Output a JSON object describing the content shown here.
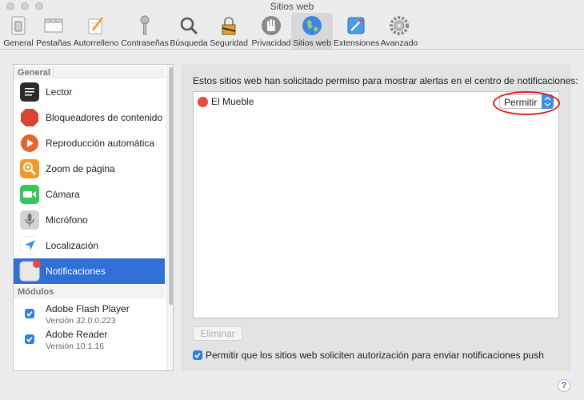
{
  "window": {
    "title": "Sitios web"
  },
  "toolbar": {
    "items": [
      {
        "label": "General",
        "icon": "switch-icon"
      },
      {
        "label": "Pestañas",
        "icon": "tabs-icon"
      },
      {
        "label": "Autorrelleno",
        "icon": "pencil-icon"
      },
      {
        "label": "Contraseñas",
        "icon": "key-icon"
      },
      {
        "label": "Búsqueda",
        "icon": "magnifier-icon"
      },
      {
        "label": "Seguridad",
        "icon": "lock-icon"
      },
      {
        "label": "Privacidad",
        "icon": "hand-icon"
      },
      {
        "label": "Sitios web",
        "icon": "globe-icon",
        "active": true
      },
      {
        "label": "Extensiones",
        "icon": "puzzle-icon"
      },
      {
        "label": "Avanzado",
        "icon": "gear-icon"
      }
    ]
  },
  "sidebar": {
    "general_header": "General",
    "items": [
      {
        "label": "Lector",
        "icon": "reader-icon",
        "color": "#2b2b2b"
      },
      {
        "label": "Bloqueadores de contenido",
        "icon": "stop-icon",
        "color": "#d9432f"
      },
      {
        "label": "Reproducción automática",
        "icon": "play-icon",
        "color": "#e8642c"
      },
      {
        "label": "Zoom de página",
        "icon": "zoom-icon",
        "color": "#f19a2b"
      },
      {
        "label": "Cámara",
        "icon": "camera-icon",
        "color": "#34c759"
      },
      {
        "label": "Micrófono",
        "icon": "microphone-icon",
        "color": "#c7c7c7"
      },
      {
        "label": "Localización",
        "icon": "location-icon",
        "color": "#3a8ef0"
      },
      {
        "label": "Notificaciones",
        "icon": "notification-icon",
        "color": "#e5e5e5",
        "selected": true
      }
    ],
    "modules_header": "Módulos",
    "modules": [
      {
        "name": "Adobe Flash Player",
        "version": "Versión 32.0.0.223",
        "checked": true
      },
      {
        "name": "Adobe Reader",
        "version": "Versión 10.1.16",
        "checked": true
      }
    ]
  },
  "main": {
    "description": "Estos sitios web han solicitado permiso para mostrar alertas en el centro de notificaciones:",
    "sites": [
      {
        "name": "El Mueble",
        "icon": "site-favicon-icon",
        "permission": "Permitir"
      }
    ],
    "remove_label": "Eliminar",
    "push_checkbox_label": "Permitir que los sitios web soliciten autorización para enviar notificaciones push",
    "push_checked": true
  },
  "help_label": "?"
}
